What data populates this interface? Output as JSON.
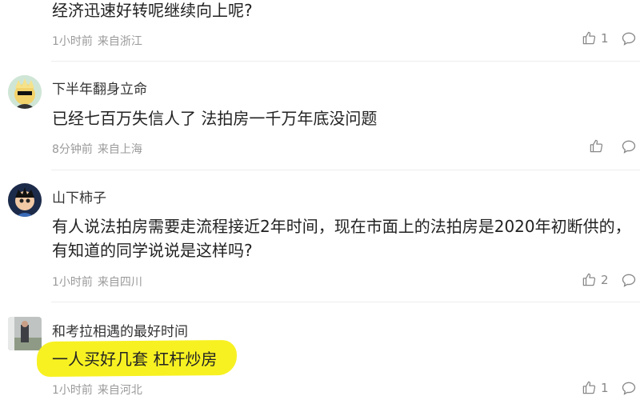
{
  "comments": [
    {
      "content": "经济迅速好转呢继续向上呢?",
      "time": "1小时前",
      "location": "来自浙江",
      "likes": "1"
    },
    {
      "username": "下半年翻身立命",
      "content": "已经七百万失信人了 法拍房一千万年底没问题",
      "time": "8分钟前",
      "location": "来自上海",
      "likes": ""
    },
    {
      "username": "山下柿子",
      "content": "有人说法拍房需要走流程接近2年时间，现在市面上的法拍房是2020年初断供的，有知道的同学说说是这样吗?",
      "time": "1小时前",
      "location": "来自四川",
      "likes": "2"
    },
    {
      "username": "和考拉相遇的最好时间",
      "content": "一人买好几套 杠杆炒房",
      "time": "1小时前",
      "location": "来自河北",
      "likes": "1"
    }
  ],
  "icons": {
    "like": "thumbs-up-outline",
    "reply": "speech-bubble-outline"
  },
  "colors": {
    "highlight": "#f7f122",
    "meta_text": "#9a9a9a"
  }
}
